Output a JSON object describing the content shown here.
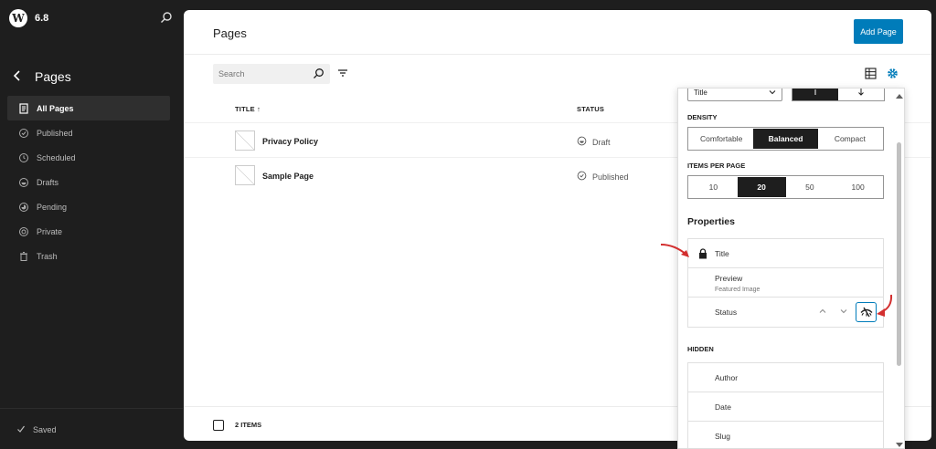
{
  "sidebar": {
    "version": "6.8",
    "title": "Pages",
    "items": [
      {
        "label": "All Pages",
        "icon": "pages-icon"
      },
      {
        "label": "Published",
        "icon": "published-icon"
      },
      {
        "label": "Scheduled",
        "icon": "scheduled-icon"
      },
      {
        "label": "Drafts",
        "icon": "drafts-icon"
      },
      {
        "label": "Pending",
        "icon": "pending-icon"
      },
      {
        "label": "Private",
        "icon": "private-icon"
      },
      {
        "label": "Trash",
        "icon": "trash-icon"
      }
    ],
    "saved_label": "Saved"
  },
  "header": {
    "title": "Pages",
    "add_button": "Add Page"
  },
  "toolbar": {
    "search_placeholder": "Search"
  },
  "table": {
    "columns": [
      "TITLE ↑",
      "STATUS"
    ],
    "rows": [
      {
        "title": "Privacy Policy",
        "status": "Draft"
      },
      {
        "title": "Sample Page",
        "status": "Published"
      }
    ]
  },
  "footer": {
    "count": "2 ITEMS"
  },
  "view_options": {
    "sort_field": "Title",
    "density_label": "DENSITY",
    "density_options": [
      "Comfortable",
      "Balanced",
      "Compact"
    ],
    "density_selected": "Balanced",
    "items_per_page_label": "ITEMS PER PAGE",
    "items_per_page_options": [
      "10",
      "20",
      "50",
      "100"
    ],
    "items_per_page_selected": "20",
    "properties_heading": "Properties",
    "visible_properties": [
      {
        "label": "Title",
        "sublabel": ""
      },
      {
        "label": "Preview",
        "sublabel": "Featured Image"
      },
      {
        "label": "Status",
        "sublabel": ""
      }
    ],
    "hidden_label": "HIDDEN",
    "hidden_properties": [
      "Author",
      "Date",
      "Slug"
    ]
  },
  "colors": {
    "accent": "#007cba",
    "annotation_arrow": "#d32f2f",
    "sidebar_bg": "#1e1e1e"
  }
}
